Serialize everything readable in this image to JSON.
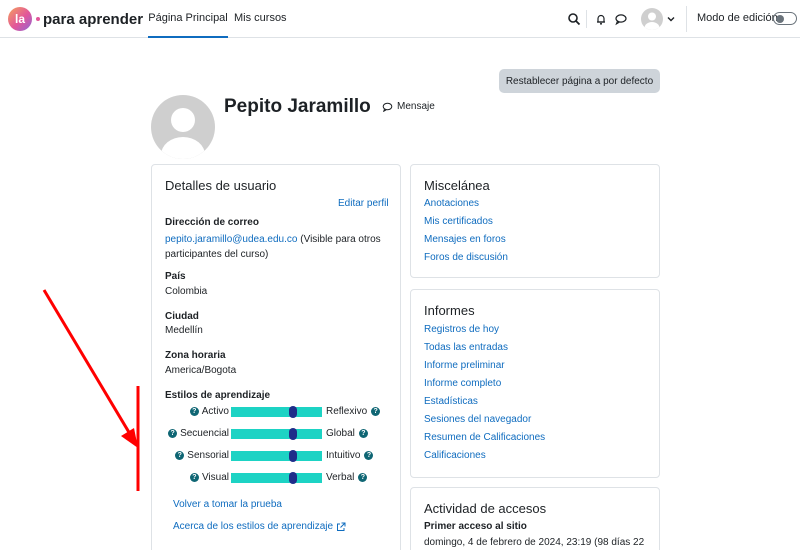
{
  "navbar": {
    "logo_badge": "la",
    "logo_text": "para aprender",
    "links": [
      "Página Principal",
      "Mis cursos"
    ],
    "edit_mode_label": "Modo de edición",
    "edit_mode_on": false
  },
  "page": {
    "reset_button": "Restablecer página a por defecto",
    "user_name": "Pepito Jaramillo",
    "message_label": "Mensaje"
  },
  "user_details": {
    "title": "Detalles de usuario",
    "edit_profile": "Editar perfil",
    "email_label": "Dirección de correo",
    "email_value": "pepito.jaramillo@udea.edu.co",
    "email_note_line1": " (Visible para otros",
    "email_note_line2": "participantes del curso)",
    "country_label": "País",
    "country_value": "Colombia",
    "city_label": "Ciudad",
    "city_value": "Medellín",
    "timezone_label": "Zona horaria",
    "timezone_value": "America/Bogota",
    "learning_styles_label": "Estilos de aprendizaje",
    "learning_styles": [
      {
        "left": "Activo",
        "right": "Reflexivo",
        "position": 0.68
      },
      {
        "left": "Secuencial",
        "right": "Global",
        "position": 0.68
      },
      {
        "left": "Sensorial",
        "right": "Intuitivo",
        "position": 0.68
      },
      {
        "left": "Visual",
        "right": "Verbal",
        "position": 0.68
      }
    ],
    "retake_test": "Volver a tomar la prueba",
    "about_styles": "Acerca de los estilos de aprendizaje"
  },
  "misc": {
    "title": "Miscelánea",
    "links": [
      "Anotaciones",
      "Mis certificados",
      "Mensajes en foros",
      "Foros de discusión"
    ]
  },
  "reports": {
    "title": "Informes",
    "links": [
      "Registros de hoy",
      "Todas las entradas",
      "Informe preliminar",
      "Informe completo",
      "Estadísticas",
      "Sesiones del navegador",
      "Resumen de Calificaciones",
      "Calificaciones"
    ]
  },
  "access": {
    "title": "Actividad de accesos",
    "first_access_label": "Primer acceso al sitio",
    "first_access_value": "domingo, 4 de febrero de 2024, 23:19  (98 días 22"
  },
  "colors": {
    "link": "#0f6cbf",
    "bar": "#1dd3c4",
    "marker": "#1f2d8a",
    "annotation_arrow": "#ff0000"
  }
}
